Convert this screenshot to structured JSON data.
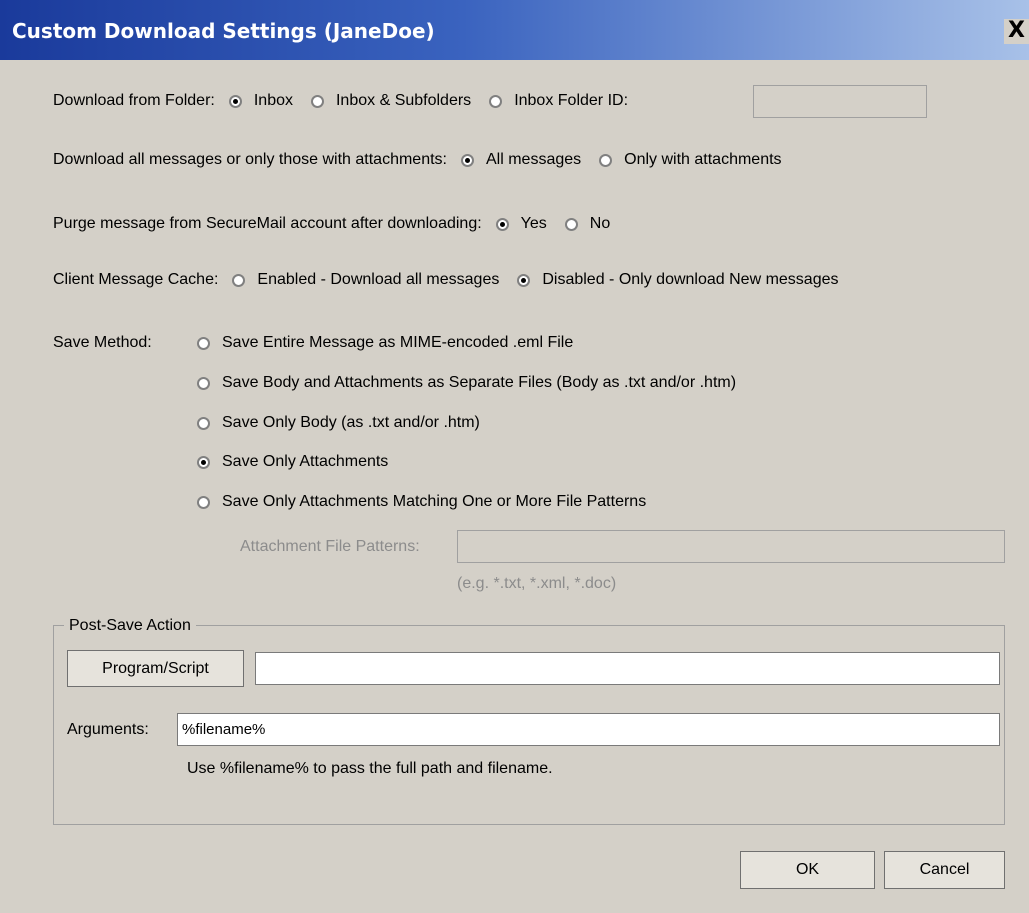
{
  "window": {
    "title": "Custom Download Settings (JaneDoe)",
    "close_label": "X"
  },
  "download_folder": {
    "label": "Download from Folder:",
    "options": [
      "Inbox",
      "Inbox & Subfolders",
      "Inbox Folder ID:"
    ],
    "selected": "Inbox",
    "folder_id_value": ""
  },
  "message_filter": {
    "label": "Download all messages or only those with attachments:",
    "options": [
      "All messages",
      "Only with attachments"
    ],
    "selected": "All messages"
  },
  "purge": {
    "label": "Purge message from SecureMail account after downloading:",
    "options": [
      "Yes",
      "No"
    ],
    "selected": "Yes"
  },
  "cache": {
    "label": "Client Message Cache:",
    "options": [
      "Enabled - Download all messages",
      "Disabled - Only download New messages"
    ],
    "selected": "Disabled - Only download New messages"
  },
  "save_method": {
    "label": "Save Method:",
    "options": [
      "Save Entire Message as MIME-encoded .eml File",
      "Save Body and Attachments as Separate Files (Body as .txt and/or .htm)",
      "Save Only Body (as .txt and/or .htm)",
      "Save Only Attachments",
      "Save Only Attachments Matching One or More File Patterns"
    ],
    "selected": "Save Only Attachments",
    "patterns_label": "Attachment File Patterns:",
    "patterns_value": "",
    "patterns_hint": "(e.g. *.txt, *.xml, *.doc)"
  },
  "post_save": {
    "group_label": "Post-Save Action",
    "program_button": "Program/Script",
    "program_value": "",
    "arguments_label": "Arguments:",
    "arguments_value": "%filename%",
    "hint": "Use %filename% to pass the full path and filename."
  },
  "buttons": {
    "ok": "OK",
    "cancel": "Cancel"
  }
}
